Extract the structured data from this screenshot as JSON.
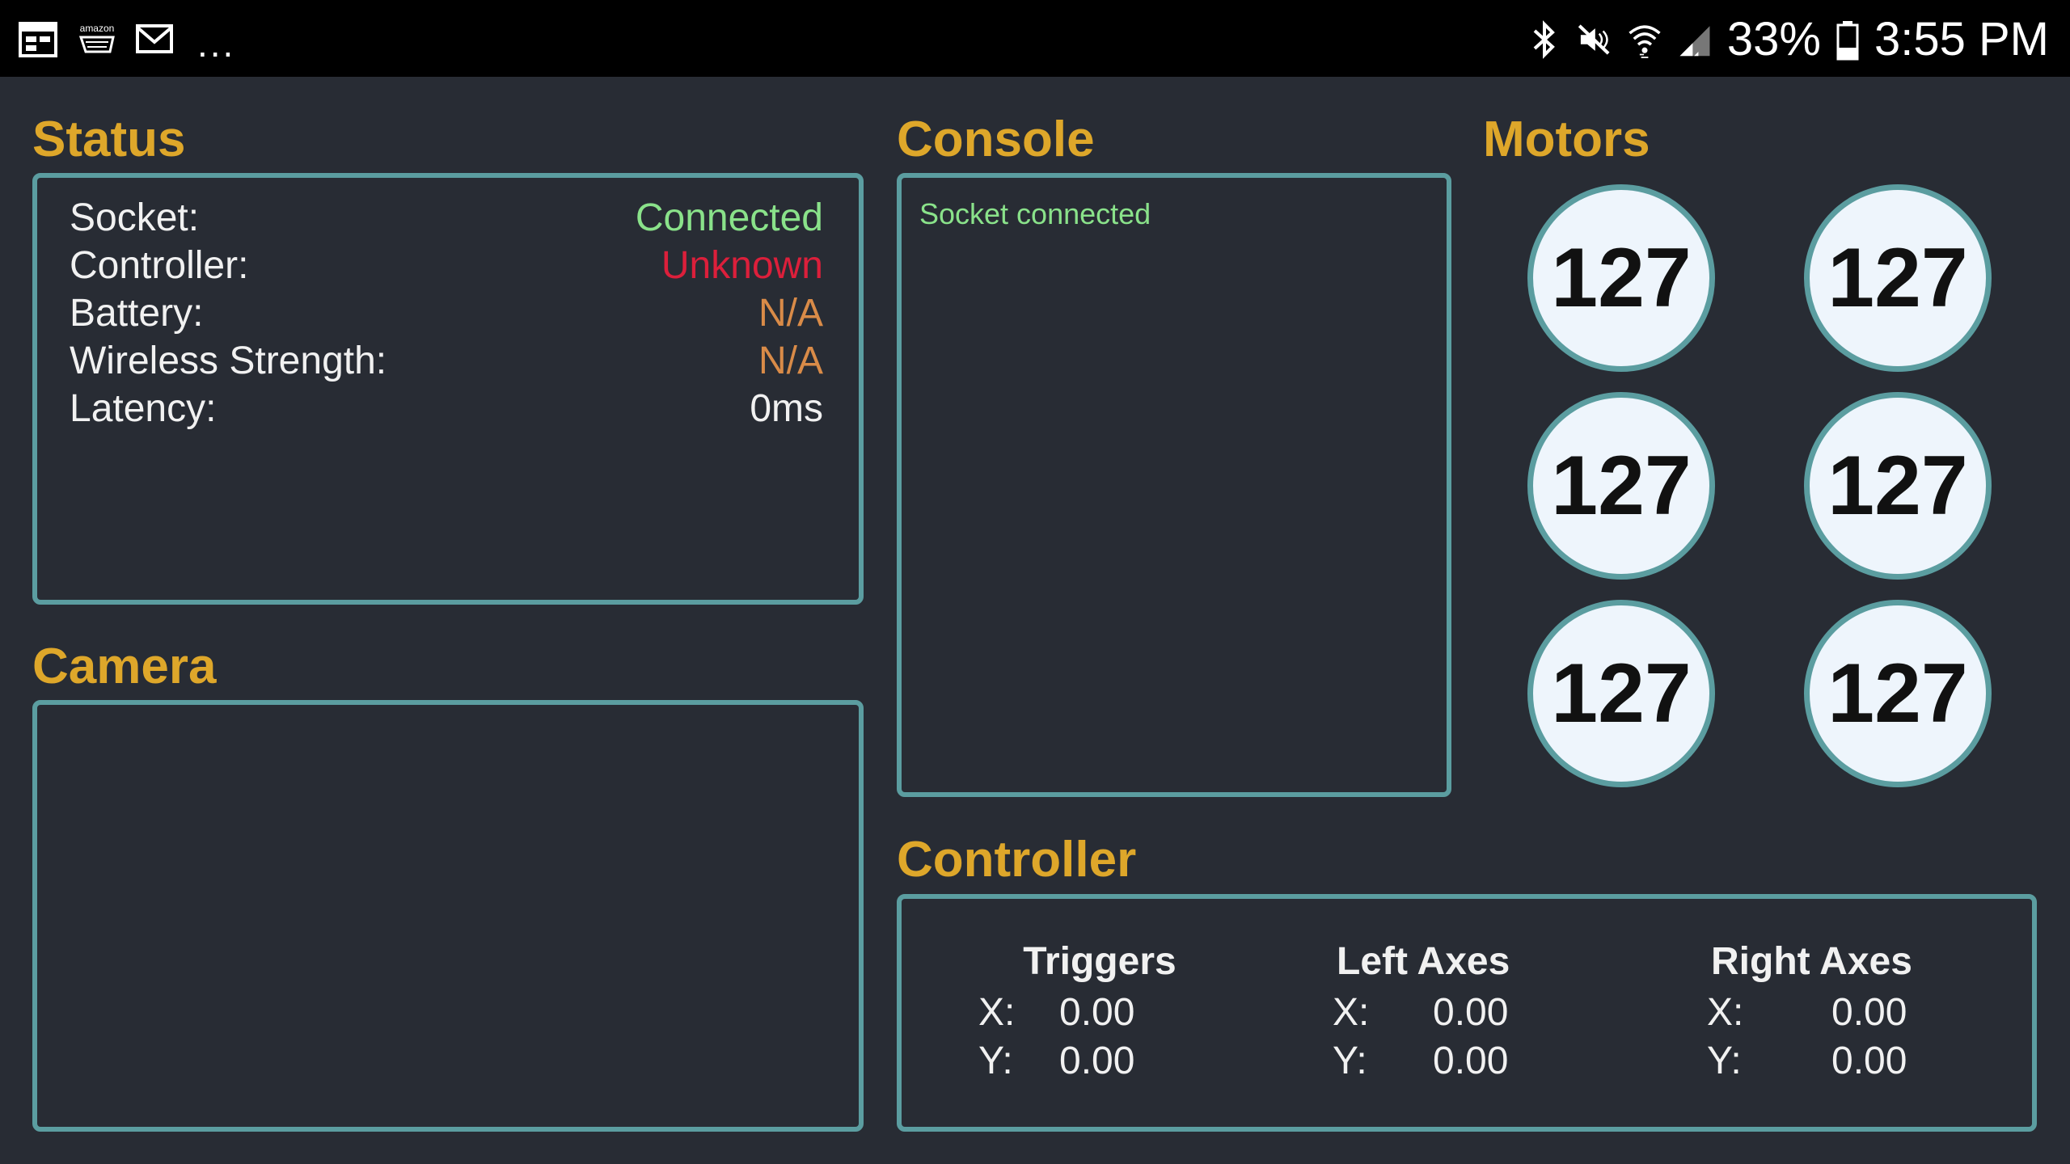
{
  "statusbar": {
    "left_icons": [
      "calendar-icon",
      "amazon-cart-icon",
      "mail-icon"
    ],
    "more": "...",
    "right_icons": [
      "bluetooth-icon",
      "mute-icon",
      "wifi-icon",
      "signal-icon"
    ],
    "battery": "33%",
    "time": "3:55 PM"
  },
  "status": {
    "title": "Status",
    "rows": [
      {
        "label": "Socket:",
        "value": "Connected",
        "color": "#8ae28a"
      },
      {
        "label": "Controller:",
        "value": "Unknown",
        "color": "#dc1f3b"
      },
      {
        "label": "Battery:",
        "value": "N/A",
        "color": "#d98b48"
      },
      {
        "label": "Wireless Strength:",
        "value": "N/A",
        "color": "#d98b48"
      },
      {
        "label": "Latency:",
        "value": "0ms",
        "color": "#f1f1f1"
      }
    ]
  },
  "console": {
    "title": "Console",
    "lines": [
      "Socket connected"
    ]
  },
  "motors": {
    "title": "Motors",
    "values": [
      "127",
      "127",
      "127",
      "127",
      "127",
      "127"
    ]
  },
  "camera": {
    "title": "Camera"
  },
  "controller": {
    "title": "Controller",
    "groups": [
      {
        "name": "Triggers",
        "x_label": "X:",
        "x": "0.00",
        "y_label": "Y:",
        "y": "0.00"
      },
      {
        "name": "Left Axes",
        "x_label": "X:",
        "x": "0.00",
        "y_label": "Y:",
        "y": "0.00"
      },
      {
        "name": "Right Axes",
        "x_label": "X:",
        "x": "0.00",
        "y_label": "Y:",
        "y": "0.00"
      }
    ]
  },
  "colors": {
    "background": "#282c34",
    "accent_title": "#dea72a",
    "panel_border": "#5b9da0"
  }
}
